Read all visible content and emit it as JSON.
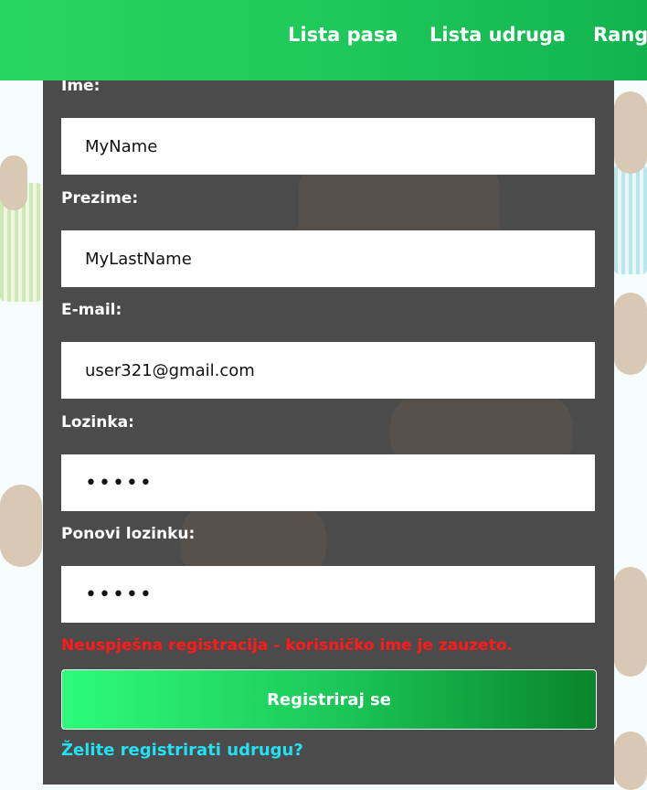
{
  "nav": {
    "items": [
      {
        "label": "Lista pasa"
      },
      {
        "label": "Lista udruga"
      },
      {
        "label": "Rang"
      }
    ]
  },
  "form": {
    "fields": [
      {
        "label": "Ime:",
        "value": "MyName",
        "type": "text"
      },
      {
        "label": "Prezime:",
        "value": "MyLastName",
        "type": "text"
      },
      {
        "label": "E-mail:",
        "value": "user321@gmail.com",
        "type": "email"
      },
      {
        "label": "Lozinka:",
        "value": "•••••",
        "type": "password"
      },
      {
        "label": "Ponovi lozinku:",
        "value": "•••••",
        "type": "password"
      }
    ],
    "error": "Neuspješna registracija - korisničko ime je zauzeto.",
    "submit_label": "Registriraj se",
    "association_link": "Želite registrirati udrugu?"
  },
  "colors": {
    "nav_green": "#1ec75a",
    "error_red": "#ff1a1a",
    "link_cyan": "#23e0f2",
    "panel_dark": "#3c3c3c"
  }
}
